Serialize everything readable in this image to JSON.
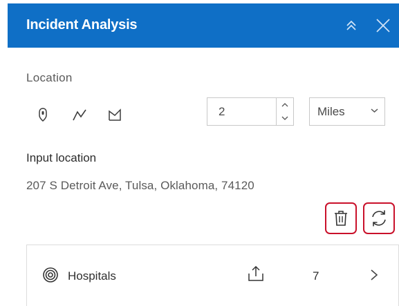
{
  "panel": {
    "title": "Incident Analysis"
  },
  "location": {
    "label": "Location",
    "distance_value": "2",
    "unit_selected": "Miles"
  },
  "input_location": {
    "label": "Input location",
    "address": "207 S Detroit Ave, Tulsa, Oklahoma, 74120"
  },
  "layers": [
    {
      "name": "Hospitals",
      "count": "7"
    }
  ],
  "colors": {
    "header": "#0f6fc6",
    "highlight": "#c9102a"
  },
  "icons": {
    "collapse": "chevrons-up-icon",
    "close": "close-icon",
    "point": "map-pin-icon",
    "line": "polyline-icon",
    "polygon": "polygon-icon",
    "delete": "trash-icon",
    "refresh": "refresh-icon",
    "layer": "target-icon",
    "export": "export-icon",
    "open": "chevron-right-icon"
  }
}
